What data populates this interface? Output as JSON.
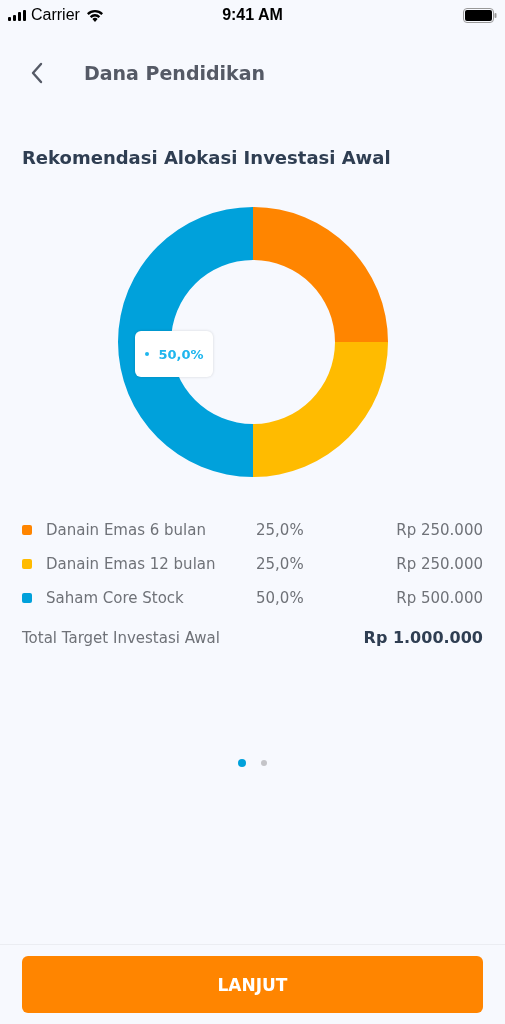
{
  "status_bar": {
    "carrier": "Carrier",
    "time": "9:41 AM"
  },
  "header": {
    "title": "Dana Pendidikan"
  },
  "section_title": "Rekomendasi Alokasi Investasi Awal",
  "chart": {
    "chart_data": {
      "type": "donut",
      "values": [
        25,
        25,
        50
      ]
    },
    "tooltip": {
      "label": "50,0%",
      "color": "#1fb6ee"
    }
  },
  "allocations": [
    {
      "name": "Danain Emas 6 bulan",
      "percent": "25,0%",
      "amount": "Rp 250.000",
      "color": "#ff8500"
    },
    {
      "name": "Danain Emas 12 bulan",
      "percent": "25,0%",
      "amount": "Rp 250.000",
      "color": "#ffbb00"
    },
    {
      "name": "Saham Core Stock",
      "percent": "50,0%",
      "amount": "Rp 500.000",
      "color": "#00a1db"
    }
  ],
  "total": {
    "label": "Total Target Investasi Awal",
    "amount": "Rp 1.000.000"
  },
  "pager": [
    {
      "selected": true
    },
    {
      "selected": false
    }
  ],
  "button": {
    "label": "LANJUT"
  }
}
